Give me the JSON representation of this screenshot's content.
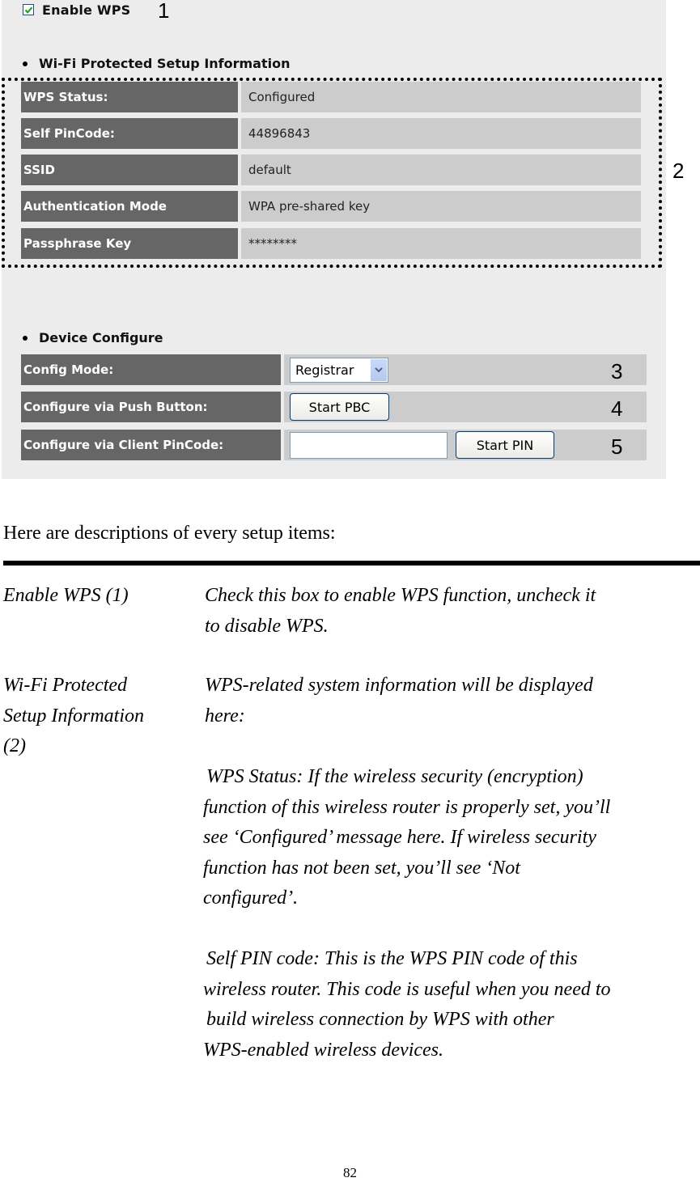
{
  "router_ui": {
    "enable_wps": {
      "label": "Enable WPS",
      "checked": true,
      "callout": "1"
    },
    "wps_info": {
      "section_title": "Wi-Fi Protected Setup Information",
      "callout": "2",
      "rows": [
        {
          "label": "WPS Status:",
          "value": "Configured"
        },
        {
          "label": "Self PinCode:",
          "value": "44896843"
        },
        {
          "label": "SSID",
          "value": "default"
        },
        {
          "label": "Authentication Mode",
          "value": "WPA pre-shared key"
        },
        {
          "label": "Passphrase Key",
          "value": "********"
        }
      ]
    },
    "device_configure": {
      "section_title": "Device Configure",
      "config_mode": {
        "label": "Config Mode:",
        "selected": "Registrar",
        "callout": "3"
      },
      "push_button": {
        "label": "Configure via Push Button:",
        "button": "Start PBC",
        "callout": "4"
      },
      "client_pin": {
        "label": "Configure via Client PinCode:",
        "input_value": "",
        "button": "Start PIN",
        "callout": "5"
      }
    }
  },
  "document": {
    "intro": "Here are descriptions of every setup items:",
    "items": [
      {
        "term": [
          "Enable WPS (1)"
        ],
        "description": [
          "Check this box to enable WPS function, uncheck it",
          "to disable WPS."
        ]
      },
      {
        "term": [
          "Wi-Fi Protected",
          "Setup Information",
          "(2)"
        ],
        "description": [
          "WPS-related system information will be displayed",
          "here:"
        ],
        "sub_items": [
          [
            "WPS Status: If the wireless security (encryption)",
            "function of this wireless router is properly set, you’ll",
            "see ‘Configured’ message here. If wireless security",
            "function has not been set, you’ll see ‘Not",
            "configured’."
          ],
          [
            "Self PIN code: This is the WPS PIN code of this",
            "wireless router. This code is useful when you need to",
            "build wireless connection by WPS with other",
            "WPS-enabled wireless devices."
          ]
        ]
      }
    ],
    "page_number": "82"
  }
}
